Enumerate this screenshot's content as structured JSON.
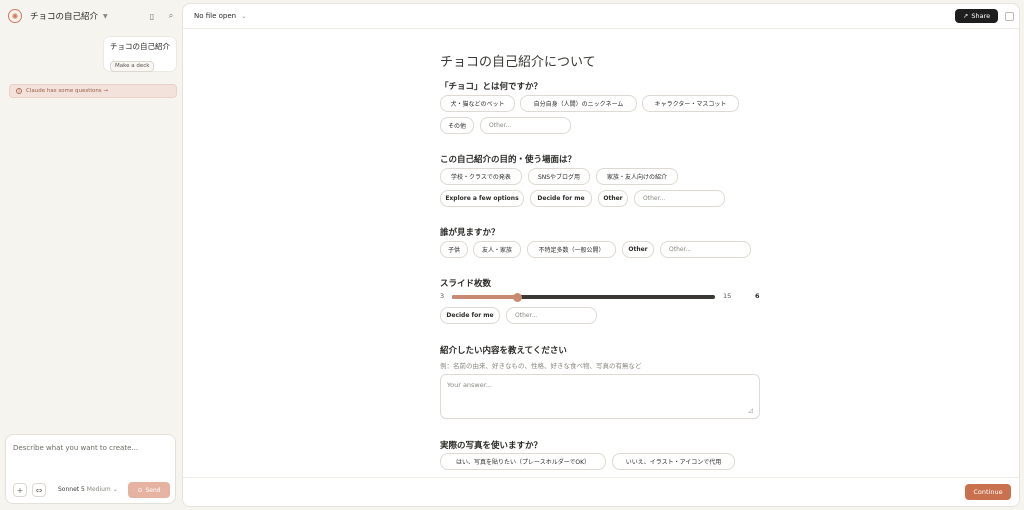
{
  "sidebar": {
    "project_title": "チョコの自己紹介",
    "user_message": {
      "title": "チョコの自己紹介",
      "button": "Make a deck"
    },
    "questions_banner": "Claude has some questions →",
    "composer": {
      "placeholder": "Describe what you want to create...",
      "model_name": "Sonnet 5",
      "model_effort": "Medium",
      "send_label": "Send"
    }
  },
  "main": {
    "file_select": "No file open",
    "share_label": "Share",
    "form_title": "チョコの自己紹介について",
    "questions": [
      {
        "title": "「チョコ」とは何ですか？",
        "options": [
          "犬・猫などのペット",
          "自分自身（人間）のニックネーム",
          "キャラクター・マスコット",
          "その他"
        ],
        "other_placeholder": "Other..."
      },
      {
        "title": "この自己紹介の目的・使う場面は？",
        "options": [
          "学校・クラスでの発表",
          "SNSやブログ用",
          "家族・友人向けの紹介",
          "Explore a few options",
          "Decide for me",
          "Other"
        ],
        "other_placeholder": "Other..."
      },
      {
        "title": "誰が見ますか？",
        "options": [
          "子供",
          "友人・家族",
          "不特定多数（一般公開）",
          "Other"
        ],
        "other_placeholder": "Other..."
      },
      {
        "title": "スライド枚数",
        "slider": {
          "min": "3",
          "max": "15",
          "value": "6",
          "fraction": 0.25
        },
        "options": [
          "Decide for me"
        ],
        "other_placeholder": "Other..."
      },
      {
        "title": "紹介したい内容を教えてください",
        "subtitle": "例：名前の由来、好きなもの、性格、好きな食べ物、写真の有無など",
        "answer_placeholder": "Your answer..."
      },
      {
        "title": "実際の写真を使いますか？",
        "options": [
          "はい、写真を貼りたい（プレースホルダーでOK）",
          "いいえ、イラスト・アイコンで代用"
        ]
      }
    ],
    "continue_label": "Continue"
  },
  "colors": {
    "accent": "#c9704f",
    "slider_fill": "#c98a72",
    "banner_bg": "#f3e2dc"
  }
}
